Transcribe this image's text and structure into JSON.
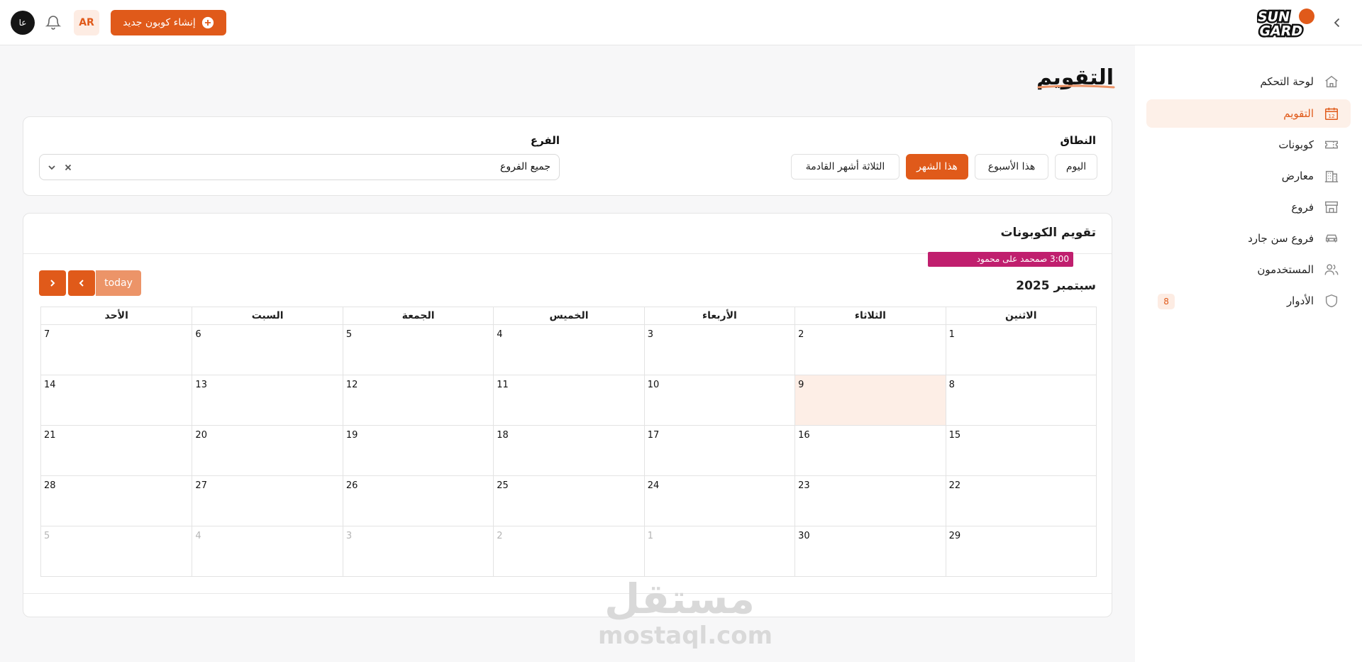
{
  "topbar": {
    "avatar_initials": "عا",
    "lang_label": "AR",
    "new_coupon_label": "إنشاء كوبون جديد",
    "logo_text": "SUN GARD"
  },
  "sidebar": {
    "items": [
      {
        "label": "لوحة التحكم",
        "icon": "home-icon"
      },
      {
        "label": "التقويم",
        "icon": "calendar-icon",
        "active": true
      },
      {
        "label": "كوبونات",
        "icon": "ticket-icon"
      },
      {
        "label": "معارض",
        "icon": "building-icon"
      },
      {
        "label": "فروع",
        "icon": "store-icon"
      },
      {
        "label": "فروع سن جارد",
        "icon": "car-icon"
      },
      {
        "label": "المستخدمون",
        "icon": "users-icon"
      },
      {
        "label": "الأدوار",
        "icon": "shield-icon",
        "badge": "8"
      }
    ]
  },
  "page": {
    "title": "التقويم"
  },
  "filters": {
    "range_label": "النطاق",
    "range_options": [
      "اليوم",
      "هذا الأسبوع",
      "هذا الشهر",
      "الثلاثة أشهر القادمة"
    ],
    "range_selected": "هذا الشهر",
    "branch_label": "الفرع",
    "branch_value": "جميع الفروع"
  },
  "calendar": {
    "card_title": "تقويم الكوبونات",
    "month_title": "سبتمبر 2025",
    "today_label": "today",
    "weekdays": [
      "الاثنين",
      "الثلاثاء",
      "الأربعاء",
      "الخميس",
      "الجمعة",
      "السبت",
      "الأحد"
    ],
    "weeks": [
      [
        "1",
        "2",
        "3",
        "4",
        "5",
        "6",
        "7"
      ],
      [
        "8",
        "9",
        "10",
        "11",
        "12",
        "13",
        "14"
      ],
      [
        "15",
        "16",
        "17",
        "18",
        "19",
        "20",
        "21"
      ],
      [
        "22",
        "23",
        "24",
        "25",
        "26",
        "27",
        "28"
      ],
      [
        "29",
        "30",
        "1",
        "2",
        "3",
        "4",
        "5"
      ]
    ],
    "today_date": "9",
    "event": {
      "time": "3:00 ص",
      "title": "محمد على محمود",
      "color": "#c01f6e"
    }
  },
  "watermark": {
    "ar": "مستقل",
    "en": "mostaql.com"
  },
  "colors": {
    "accent": "#e05a1a",
    "accent_light": "#fdf0e8",
    "event": "#c01f6e"
  }
}
